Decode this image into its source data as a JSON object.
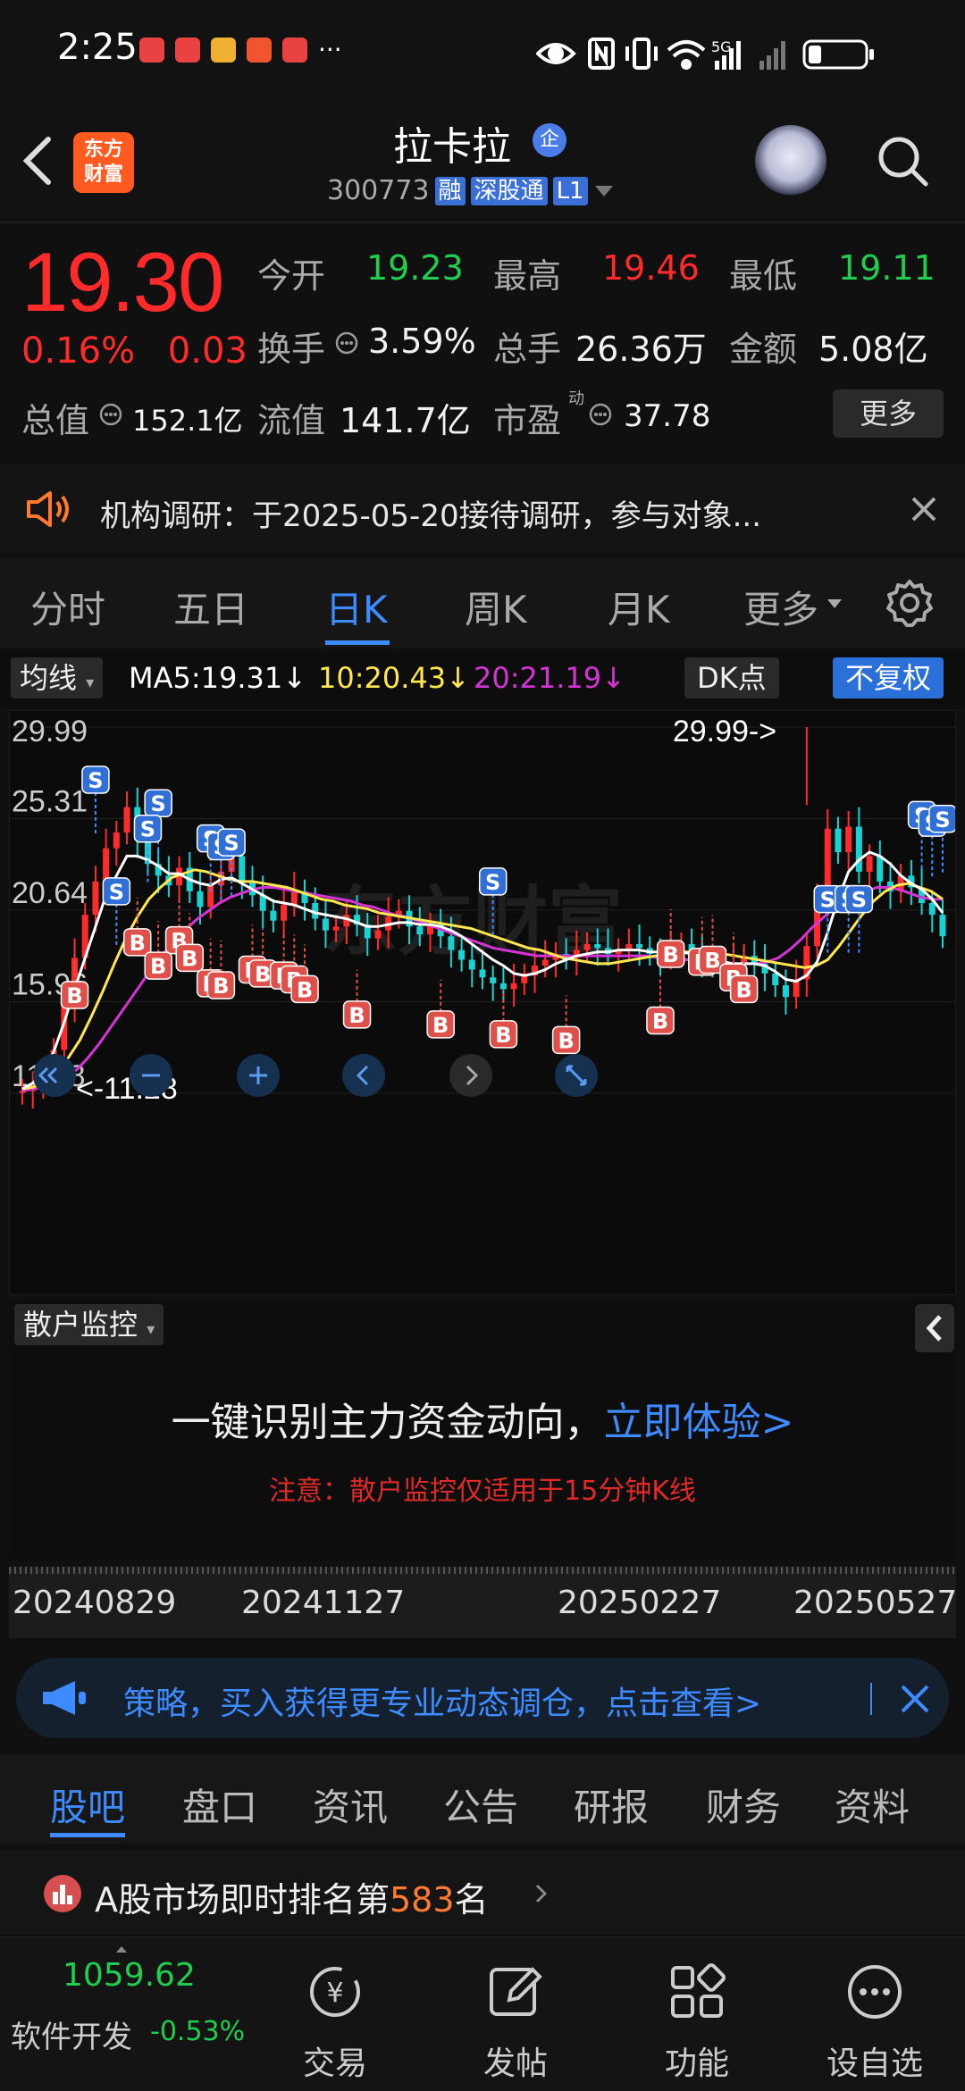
{
  "status_bar": {
    "time": "2:25",
    "dots": "···",
    "network": "5G"
  },
  "header": {
    "logo_line1": "东方",
    "logo_line2": "财富",
    "stock_name": "拉卡拉",
    "name_badge": "企",
    "code": "300773",
    "tags": [
      "融",
      "深股通",
      "L1"
    ]
  },
  "quote": {
    "price": "19.30",
    "change_pct": "0.16%",
    "change_amt": "0.03",
    "open_label": "今开",
    "open": "19.23",
    "high_label": "最高",
    "high": "19.46",
    "low_label": "最低",
    "low": "19.11",
    "turnover_label": "换手",
    "turnover": "3.59%",
    "volume_label": "总手",
    "volume": "26.36万",
    "amount_label": "金额",
    "amount": "5.08亿",
    "mktcap_label": "总值",
    "mktcap": "152.1亿",
    "float_label": "流值",
    "float": "141.7亿",
    "pe_label": "市盈",
    "pe_sup": "动",
    "pe": "37.78",
    "more_label": "更多"
  },
  "notice": {
    "text": "机构调研：于2025-05-20接待调研，参与对象..."
  },
  "period_tabs": [
    "分时",
    "五日",
    "日K",
    "周K",
    "月K",
    "更多"
  ],
  "active_tab": "日K",
  "chart_toolbar": {
    "ma_button": "均线",
    "ma5": "MA5:19.31",
    "ma10": "10:20.43",
    "ma20": "20:21.19",
    "dk_button": "DK点",
    "adjust_button": "不复权"
  },
  "colors": {
    "up": "#ff2b2b",
    "down": "#1fce4f",
    "ma5": "#ffffff",
    "ma10": "#ffe84d",
    "ma20": "#d633d6",
    "accent": "#3d8bff"
  },
  "chart_data": {
    "type": "candlestick",
    "y_ticks": [
      "29.99",
      "25.31",
      "20.64",
      "15.96",
      "11.28"
    ],
    "ylim": [
      11.28,
      29.99
    ],
    "max_annotation": "29.99->",
    "min_annotation": "<-11.28",
    "x_ticks": [
      "20240829",
      "20241127",
      "20250227",
      "20250527"
    ],
    "watermark": "东方财富",
    "signal_labels": {
      "buy": "B",
      "sell": "S"
    },
    "closes": [
      11.4,
      11.6,
      12.0,
      13.5,
      15.8,
      18.2,
      20.4,
      22.1,
      23.8,
      24.6,
      25.9,
      24.2,
      23.0,
      22.4,
      21.9,
      22.8,
      21.6,
      20.8,
      21.9,
      22.6,
      23.4,
      22.1,
      21.4,
      20.6,
      20.1,
      20.9,
      21.6,
      21.0,
      20.2,
      19.6,
      19.8,
      20.4,
      19.9,
      19.2,
      19.6,
      20.3,
      20.6,
      19.8,
      19.4,
      19.9,
      19.3,
      18.6,
      18.1,
      17.6,
      17.2,
      16.9,
      16.6,
      16.9,
      17.3,
      17.8,
      18.1,
      18.4,
      18.2,
      18.6,
      18.9,
      18.7,
      18.4,
      18.6,
      18.9,
      18.7,
      18.4,
      18.2,
      18.6,
      18.9,
      18.4,
      18.1,
      17.8,
      17.6,
      17.9,
      18.3,
      17.9,
      17.4,
      16.8,
      16.2,
      17.1,
      18.8,
      21.2,
      24.8,
      23.6,
      24.9,
      22.6,
      23.4,
      22.1,
      21.6,
      22.4,
      21.8,
      21.0,
      20.4,
      19.3
    ],
    "ma5": [
      11.5,
      11.8,
      12.4,
      13.4,
      14.9,
      16.6,
      18.2,
      19.8,
      21.4,
      22.4,
      23.4,
      23.4,
      23.2,
      22.9,
      22.5,
      22.5,
      22.2,
      22.0,
      21.9,
      22.2,
      22.3,
      22.0,
      21.7,
      21.4,
      21.1,
      21.0,
      20.9,
      20.7,
      20.5,
      20.4,
      20.3,
      20.2,
      20.0,
      19.8,
      19.8,
      19.9,
      20.0,
      20.0,
      19.9,
      19.9,
      19.8,
      19.6,
      19.3,
      18.9,
      18.5,
      18.1,
      17.8,
      17.4,
      17.3,
      17.4,
      17.6,
      17.9,
      18.1,
      18.3,
      18.4,
      18.5,
      18.5,
      18.6,
      18.6,
      18.6,
      18.5,
      18.5,
      18.5,
      18.5,
      18.4,
      18.3,
      18.2,
      18.0,
      17.9,
      17.9,
      17.9,
      17.8,
      17.5,
      17.1,
      17.0,
      17.3,
      18.0,
      19.5,
      21.2,
      22.6,
      23.2,
      23.6,
      23.4,
      23.0,
      22.4,
      22.0,
      21.7,
      21.2,
      20.5
    ],
    "ma10": [
      11.5,
      11.6,
      11.9,
      12.4,
      13.1,
      14.0,
      15.2,
      16.5,
      17.9,
      19.2,
      20.3,
      21.2,
      21.8,
      22.3,
      22.5,
      22.7,
      22.6,
      22.4,
      22.2,
      22.1,
      22.1,
      22.0,
      21.9,
      21.8,
      21.6,
      21.4,
      21.2,
      21.1,
      20.9,
      20.8,
      20.7,
      20.5,
      20.4,
      20.3,
      20.2,
      20.1,
      20.0,
      19.9,
      19.8,
      19.7,
      19.5,
      19.3,
      19.1,
      18.9,
      18.7,
      18.6,
      18.4,
      18.2,
      18.1,
      18.0,
      17.9,
      17.9,
      18.0,
      18.1,
      18.2,
      18.3,
      18.4,
      18.5,
      18.5,
      18.5,
      18.4,
      18.4,
      18.3,
      18.2,
      18.1,
      18.0,
      17.9,
      17.8,
      17.7,
      17.8,
      18.1,
      18.8,
      19.6,
      20.4,
      21.1,
      21.6,
      21.9,
      22.0,
      21.8,
      21.6,
      21.2
    ],
    "ma20": [
      11.4,
      11.5,
      11.6,
      11.8,
      12.1,
      12.5,
      13.1,
      13.8,
      14.6,
      15.4,
      16.2,
      17.0,
      17.8,
      18.5,
      19.1,
      19.7,
      20.2,
      20.6,
      21.0,
      21.3,
      21.5,
      21.7,
      21.8,
      21.8,
      21.7,
      21.6,
      21.5,
      21.4,
      21.3,
      21.2,
      21.1,
      20.9,
      20.8,
      20.6,
      20.4,
      20.3,
      20.1,
      19.9,
      19.7,
      19.5,
      19.3,
      19.1,
      18.9,
      18.7,
      18.6,
      18.5,
      18.4,
      18.3,
      18.3,
      18.3,
      18.3,
      18.3,
      18.3,
      18.3,
      18.3,
      18.3,
      18.3,
      18.3,
      18.2,
      18.2,
      18.1,
      18.1,
      18.0,
      18.0,
      17.9,
      17.9,
      17.9,
      17.9,
      18.0,
      18.2,
      18.6,
      19.1,
      19.7,
      20.2,
      20.7,
      21.1,
      21.4,
      21.6,
      21.8,
      21.8,
      21.7,
      21.5,
      21.3,
      21.2,
      21.19
    ],
    "sell_signals": [
      [
        6,
        27.3
      ],
      [
        11,
        26.1
      ],
      [
        10,
        24.8
      ],
      [
        15,
        24.3
      ],
      [
        16,
        23.9
      ],
      [
        17,
        24.1
      ],
      [
        8,
        21.6
      ],
      [
        38,
        22.1
      ],
      [
        66,
        21.2
      ],
      [
        67,
        21.2
      ],
      [
        68,
        21.2
      ],
      [
        73,
        25.5
      ],
      [
        74,
        25.1
      ],
      [
        75,
        25.3
      ]
    ],
    "buy_signals": [
      [
        4,
        16.3
      ],
      [
        9,
        19.0
      ],
      [
        11,
        17.8
      ],
      [
        13,
        19.1
      ],
      [
        14,
        18.2
      ],
      [
        15,
        16.9
      ],
      [
        16,
        16.8
      ],
      [
        19,
        17.6
      ],
      [
        20,
        17.4
      ],
      [
        21,
        17.3
      ],
      [
        22,
        17.1
      ],
      [
        23,
        16.6
      ],
      [
        27,
        15.3
      ],
      [
        34,
        14.8
      ],
      [
        39,
        14.3
      ],
      [
        44,
        14.0
      ],
      [
        52,
        15.0
      ],
      [
        53,
        18.4
      ],
      [
        55,
        18.0
      ],
      [
        56,
        18.1
      ],
      [
        58,
        17.2
      ],
      [
        59,
        16.6
      ]
    ]
  },
  "chart_controls": [
    "rewind",
    "zoom-out",
    "zoom-in",
    "prev",
    "next",
    "fullscreen"
  ],
  "monitor": {
    "selector": "散户监控",
    "headline": "一键识别主力资金动向，",
    "cta": "立即体验>",
    "warning": "注意：散户监控仅适用于15分钟K线"
  },
  "strategy_banner": {
    "text": "策略，买入获得更专业动态调仓，点击查看>"
  },
  "bottom_tabs": [
    "股吧",
    "盘口",
    "资讯",
    "公告",
    "研报",
    "财务",
    "资料"
  ],
  "rank": {
    "prefix": "A股市场即时排名第",
    "rank": "583",
    "suffix": "名"
  },
  "nav": {
    "index_value": "1059.62",
    "sector": "软件开发",
    "sector_change": "-0.53%",
    "items": [
      "交易",
      "发帖",
      "功能",
      "设自选"
    ]
  }
}
